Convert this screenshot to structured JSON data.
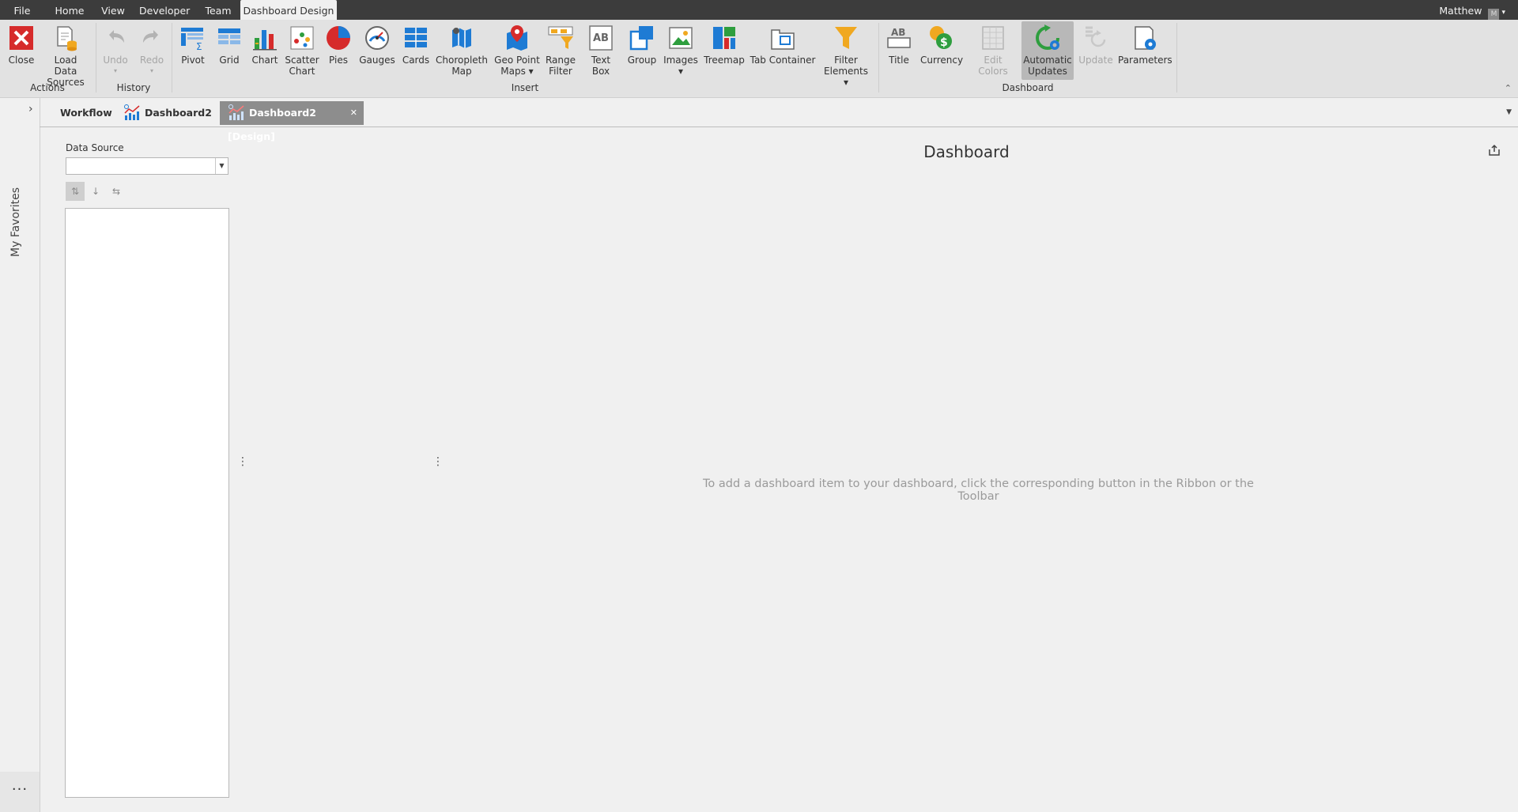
{
  "menu": {
    "tabs": [
      "File",
      "Home",
      "View",
      "Developer",
      "Team",
      "Dashboard Design"
    ],
    "active": "Dashboard Design",
    "user": "Matthew",
    "avatar_letter": "M",
    "user_caret": "▾"
  },
  "ribbon": {
    "groups": {
      "actions": "Actions",
      "history": "History",
      "insert": "Insert",
      "dashboard": "Dashboard"
    },
    "buttons": {
      "close": "Close",
      "load_data_sources": "Load Data\nSources",
      "undo": "Undo",
      "redo": "Redo",
      "pivot": "Pivot",
      "grid": "Grid",
      "chart": "Chart",
      "scatter_chart": "Scatter\nChart",
      "pies": "Pies",
      "gauges": "Gauges",
      "cards": "Cards",
      "choropleth_map": "Choropleth\nMap",
      "geo_point_maps": "Geo Point\nMaps ▾",
      "range_filter": "Range\nFilter",
      "text_box": "Text Box",
      "group": "Group",
      "images": "Images\n▾",
      "treemap": "Treemap",
      "tab_container": "Tab Container",
      "filter_elements": "Filter\nElements ▾",
      "title": "Title",
      "currency": "Currency",
      "edit_colors": "Edit Colors",
      "automatic_updates": "Automatic\nUpdates",
      "update": "Update",
      "parameters": "Parameters"
    },
    "icon_text": {
      "text_box": "AB",
      "title": "AB",
      "currency_coin": "$"
    },
    "collapse_glyph": "⌃"
  },
  "tabs": {
    "workflow": "Workflow",
    "dashboard2": "Dashboard2",
    "dashboard2_design": "Dashboard2 [Design]",
    "close_glyph": "✕",
    "dropdown_glyph": "▼"
  },
  "sidebar": {
    "favorites": "My Favorites",
    "expand_glyph": "›",
    "more": "···"
  },
  "data_source": {
    "label": "Data Source",
    "value": "",
    "combo_arrow": "▼",
    "tool_glyphs": [
      "⇅",
      "↓",
      "⇆"
    ]
  },
  "splitter_glyph": "⋮",
  "dashboard": {
    "title": "Dashboard",
    "hint": "To add a dashboard item to your dashboard, click the corresponding button in the Ribbon or the Toolbar"
  },
  "colors": {
    "menubar": "#3c3c3c",
    "ribbon": "#e2e2e2",
    "accent_blue": "#1e7bd4",
    "close_red": "#d62b2b",
    "tab_active": "#8d8d8d"
  }
}
